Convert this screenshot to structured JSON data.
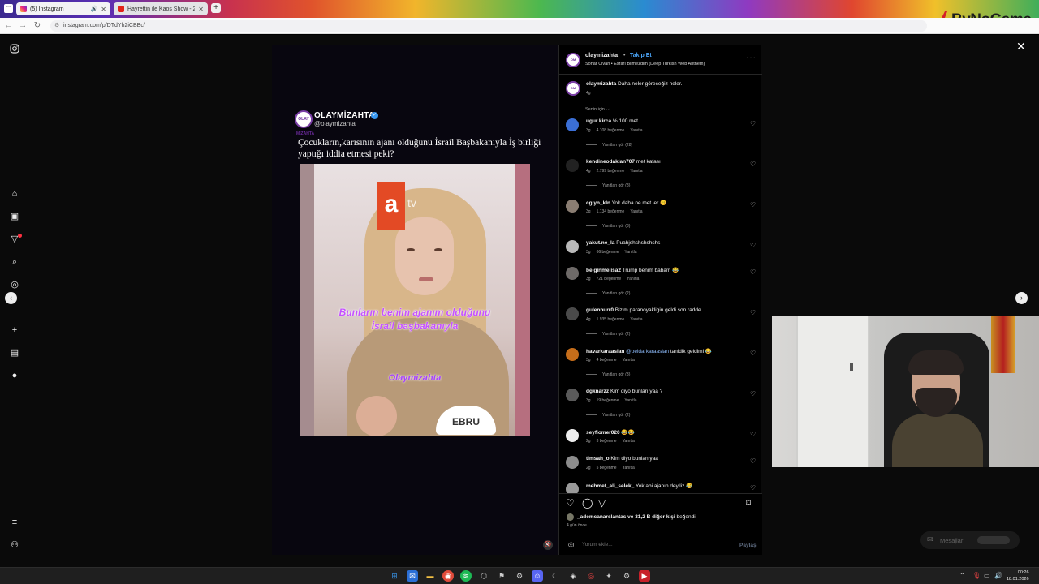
{
  "browser": {
    "tabs": [
      {
        "title": "(5) Instagram",
        "active": true
      },
      {
        "title": "Hayrettin ile Kaos Show - 2 Su",
        "active": false
      }
    ],
    "new_tab": "+",
    "url": "instagram.com/p/DTdYh2iCBBc/",
    "overlay_brand": "ByNoGame"
  },
  "post": {
    "username": "olaymizahta",
    "separator": "•",
    "follow_label": "Takip Et",
    "music": "Sonar Civan • Esrarı Bilmezdim (Deep Turkish Web Anthem)",
    "video": {
      "account_name": "OLAYMİZAHTA",
      "account_handle": "@olaymizahta",
      "caption": "Çocukların,karısının ajanı olduğunu İsrail Başbakanıyla İş birliği yaptığı iddia etmesi peki?",
      "channel_logo": "a",
      "channel_tv": "tv",
      "subtitle_line1": "Bunların benim ajanım olduğunu",
      "subtitle_line2": "İsrail başbakanıyla",
      "watermark": "Olaymizahta",
      "nameplate": "EBRU",
      "logo_text": "OLAY MİZAHTA"
    },
    "description": {
      "user": "olaymizahta",
      "text": "Daha neler göreceğiz neler..",
      "time": "4g"
    },
    "sort_label": "Senin için ⌵",
    "comments": [
      {
        "user": "ugur.kirca",
        "text": "% 100 met",
        "time": "3g",
        "likes": "4.108 beğenme",
        "reply": "Yanıtla",
        "replies": "Yanıtları gör (28)",
        "avatar_color": "#3b6fd6"
      },
      {
        "user": "kendineodaklan707",
        "text": "met kafası",
        "time": "4g",
        "likes": "2.799 beğenme",
        "reply": "Yanıtla",
        "replies": "Yanıtları gör (8)",
        "avatar_color": "#222222"
      },
      {
        "user": "cglyn_kln",
        "text": "Yok daha ne met ler 😊",
        "time": "3g",
        "likes": "1.134 beğenme",
        "reply": "Yanıtla",
        "replies": "Yanıtları gör (3)",
        "avatar_color": "#8a7d72"
      },
      {
        "user": "yakut.ne_la",
        "text": "Puahjshshshshshs",
        "time": "3g",
        "likes": "66 beğenme",
        "reply": "Yanıtla",
        "replies": "",
        "avatar_color": "#b9b9b9"
      },
      {
        "user": "belginmelisa2",
        "text": "Trump benim babam 😂",
        "time": "3g",
        "likes": "721 beğenme",
        "reply": "Yanıtla",
        "replies": "Yanıtları gör (2)",
        "avatar_color": "#6e6a68"
      },
      {
        "user": "gulennurr0",
        "text": "Bizim paranoyakligin geldi son radde",
        "time": "4g",
        "likes": "1.935 beğenme",
        "reply": "Yanıtla",
        "replies": "Yanıtları gör (2)",
        "avatar_color": "#4a4a4a"
      },
      {
        "user": "havarkaraaslan",
        "mention": "@peldarkaraaslan",
        "text": "tanidik geldimi 😂",
        "time": "3g",
        "likes": "4 beğenme",
        "reply": "Yanıtla",
        "replies": "Yanıtları gör (3)",
        "avatar_color": "#c56d1a"
      },
      {
        "user": "dgknarzz",
        "text": "Kim diyo bunları yaa ?",
        "time": "3g",
        "likes": "19 beğenme",
        "reply": "Yanıtla",
        "replies": "Yanıtları gör (2)",
        "avatar_color": "#5a5a5a"
      },
      {
        "user": "seyfiomer020",
        "text": "😂😂",
        "time": "2g",
        "likes": "3 beğenme",
        "reply": "Yanıtla",
        "replies": "",
        "avatar_color": "#eeeeee"
      },
      {
        "user": "timsah_o",
        "text": "Kim diyo bunlan yaa",
        "time": "2g",
        "likes": "5 beğenme",
        "reply": "Yanıtla",
        "replies": "",
        "avatar_color": "#8c8c8c"
      },
      {
        "user": "mehmet_ali_selek_",
        "text": "Yok abi ajanın deyiliz 😂",
        "time": "",
        "likes": "",
        "reply": "",
        "replies": "",
        "avatar_color": "#9a9a9a"
      }
    ],
    "liked_by_user": "_ademcanarslantas",
    "liked_by_rest": "ve 31,2 B diğer kişi",
    "liked_by_suffix": "beğendi",
    "time_ago": "4 gün önce",
    "comment_placeholder": "Yorum ekle...",
    "share_label": "Paylaş"
  },
  "messages_label": "Mesajlar",
  "clock": {
    "time": "00:26",
    "date": "18.01.2026"
  },
  "colors": {
    "link": "#4aa3f5",
    "badge": "#ff3040",
    "panel_bg": "#000000"
  }
}
